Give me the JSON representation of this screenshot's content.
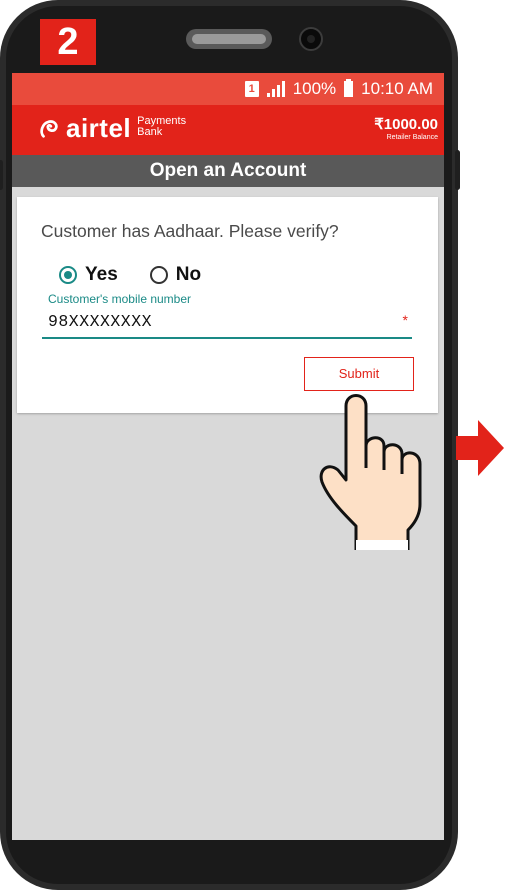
{
  "step_badge": "2",
  "status_bar": {
    "sim_label": "1",
    "battery_percent": "100%",
    "time": "10:10 AM"
  },
  "app_bar": {
    "brand_name": "airtel",
    "brand_sub_line1": "Payments",
    "brand_sub_line2": "Bank",
    "balance_amount": "₹1000.00",
    "balance_label": "Retailer Balance"
  },
  "page_title": "Open an Account",
  "form": {
    "question": "Customer has Aadhaar. Please verify?",
    "options": [
      {
        "label": "Yes",
        "selected": true
      },
      {
        "label": "No",
        "selected": false
      }
    ],
    "mobile_label": "Customer's mobile number",
    "mobile_value": "98XXXXXXXX",
    "required_marker": "*",
    "submit_label": "Submit"
  },
  "colors": {
    "brand_red": "#e2231a",
    "status_red": "#e94b3c",
    "accent_teal": "#1a8a86",
    "title_gray": "#595959"
  },
  "icons": [
    "sim-icon",
    "signal-icon",
    "battery-icon",
    "airtel-logo-icon",
    "pointing-hand-icon",
    "arrow-right-icon"
  ]
}
